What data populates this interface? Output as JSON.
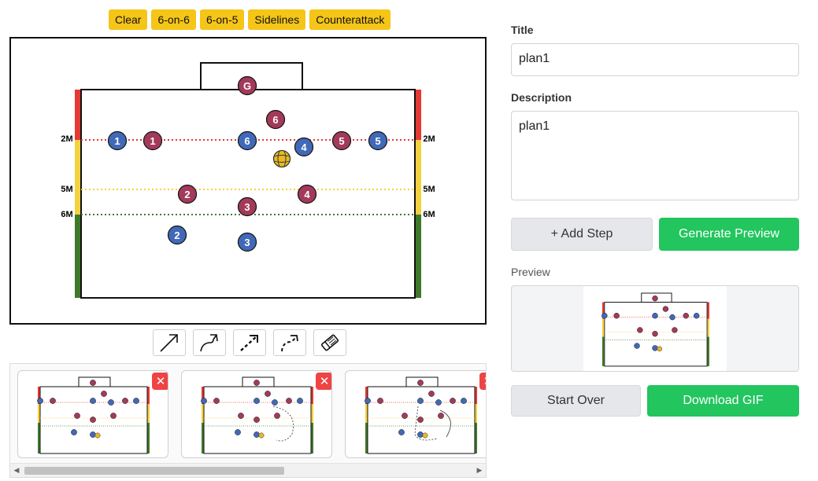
{
  "presets": [
    "Clear",
    "6-on-6",
    "6-on-5",
    "Sidelines",
    "Counterattack"
  ],
  "court": {
    "zone_labels": [
      "2M",
      "5M",
      "6M"
    ],
    "goalkeeper": "G",
    "blue_players": [
      "1",
      "2",
      "3",
      "4",
      "5",
      "6"
    ],
    "red_players": [
      "1",
      "2",
      "3",
      "4",
      "5",
      "6"
    ],
    "colors": {
      "blue_player": "#4169b8",
      "red_player": "#a33a5a",
      "line_2m": "#e53935",
      "line_5m": "#f5d140",
      "line_6m": "#3f7a2b",
      "ball": "#e8b923"
    }
  },
  "tools": [
    {
      "name": "straight-arrow-tool-icon"
    },
    {
      "name": "curved-arrow-tool-icon"
    },
    {
      "name": "dashed-arrow-tool-icon"
    },
    {
      "name": "dashed-curved-arrow-tool-icon"
    },
    {
      "name": "eraser-tool-icon"
    }
  ],
  "steps": {
    "remove_label": "✕",
    "count": 3
  },
  "form": {
    "title_label": "Title",
    "title_value": "plan1",
    "description_label": "Description",
    "description_value": "plan1",
    "add_step_label": "+ Add Step",
    "generate_preview_label": "Generate Preview",
    "preview_label": "Preview",
    "start_over_label": "Start Over",
    "download_gif_label": "Download GIF"
  },
  "colors": {
    "preset_button": "#f5c518",
    "primary_green": "#22c55e",
    "remove_red": "#ef4444"
  }
}
